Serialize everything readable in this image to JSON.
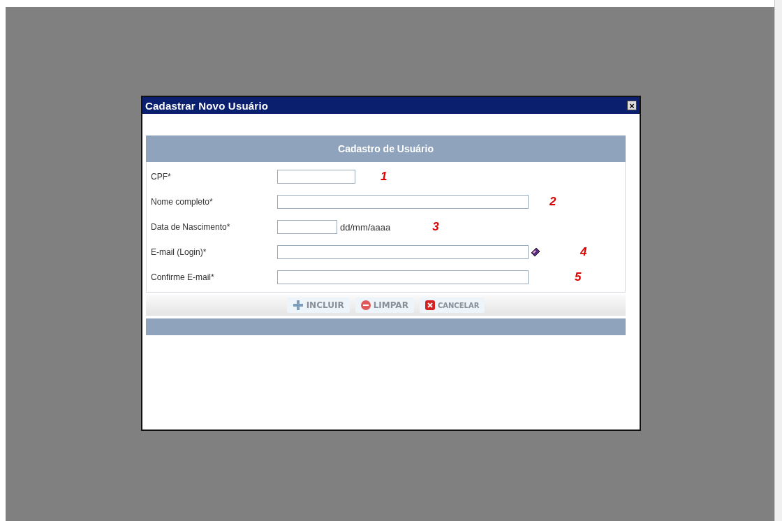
{
  "dialog": {
    "title": "Cadastrar Novo Usuário",
    "close": "×"
  },
  "form": {
    "heading": "Cadastro de Usuário",
    "fields": [
      {
        "label": "CPF*",
        "kind": "short",
        "lookup": false,
        "note": "1"
      },
      {
        "label": "Nome completo*",
        "kind": "long",
        "lookup": false,
        "note": "2"
      },
      {
        "label": "Data de Nascimento*",
        "kind": "date",
        "hint": "dd/mm/aaaa",
        "lookup": false,
        "note": "3"
      },
      {
        "label": "E-mail (Login)*",
        "kind": "long",
        "lookup": true,
        "note": "4"
      },
      {
        "label": "Confirme E-mail*",
        "kind": "long",
        "lookup": false,
        "note": "5"
      }
    ]
  },
  "buttons": [
    {
      "label": "INCLUIR",
      "kind": "add"
    },
    {
      "label": "LIMPAR",
      "kind": "clear"
    },
    {
      "label": "CANCELAR",
      "kind": "cancel"
    }
  ]
}
